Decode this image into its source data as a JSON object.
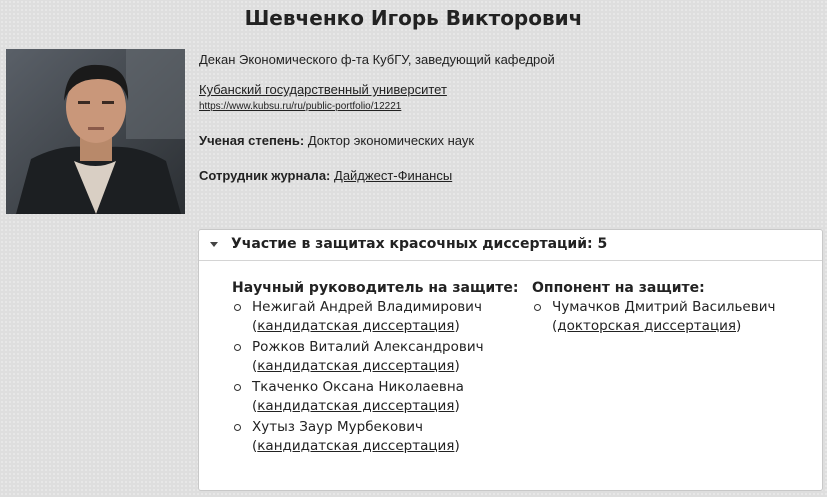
{
  "page_title": "Шевченко Игорь Викторович",
  "profile": {
    "position": "Декан Экономического ф-та КубГУ, заведующий кафедрой",
    "organization": "Кубанский государственный университет",
    "url": "https://www.kubsu.ru/ru/public-portfolio/12221",
    "degree_label": "Ученая степень:",
    "degree_value": "Доктор экономических наук",
    "journal_label": "Сотрудник журнала:",
    "journal_value": "Дайджест-Финансы"
  },
  "panel": {
    "title": "Участие в защитах красочных диссертаций: 5",
    "advisor": {
      "heading": "Научный руководитель на защите:",
      "items": [
        {
          "name": "Нежигай Андрей Владимирович",
          "link": "кандидатская диссертация"
        },
        {
          "name": "Рожков Виталий Александрович",
          "link": "кандидатская диссертация"
        },
        {
          "name": "Ткаченко Оксана Николаевна",
          "link": "кандидатская диссертация"
        },
        {
          "name": "Хутыз Заур Мурбекович",
          "link": "кандидатская диссертация"
        }
      ]
    },
    "opponent": {
      "heading": "Оппонент на защите:",
      "items": [
        {
          "name": "Чумачков Дмитрий Васильевич",
          "link": "докторская диссертация"
        }
      ]
    }
  },
  "icons": {
    "caret": "caret-down-icon",
    "bullet": "circle-bullet-icon"
  }
}
